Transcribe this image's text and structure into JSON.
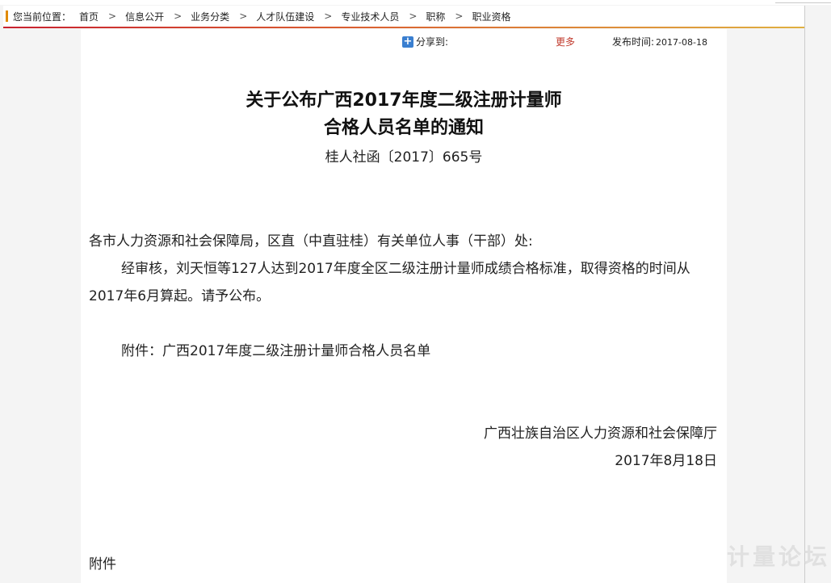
{
  "breadcrumb": {
    "label": "您当前位置：",
    "items": [
      "首页",
      "信息公开",
      "业务分类",
      "人才队伍建设",
      "专业技术人员",
      "职称",
      "职业资格"
    ]
  },
  "meta": {
    "share_label": "分享到:",
    "more_label": "更多",
    "publish_label": "发布时间:",
    "publish_date": "2017-08-18"
  },
  "article": {
    "title_line1": "关于公布广西2017年度二级注册计量师",
    "title_line2": "合格人员名单的通知",
    "doc_number": "桂人社函〔2017〕665号",
    "salutation": "各市人力资源和社会保障局，区直（中直驻桂）有关单位人事（干部）处:",
    "paragraph": "经审核，刘天恒等127人达到2017年度全区二级注册计量师成绩合格标准，取得资格的时间从2017年6月算起。请予公布。",
    "attachment_line": "附件：广西2017年度二级注册计量师合格人员名单",
    "signer": "广西壮族自治区人力资源和社会保障厅",
    "sign_date": "2017年8月18日",
    "attachment_heading": "附件"
  },
  "watermark": "计量论坛",
  "colors": {
    "breadcrumb_marker": "#e08a00",
    "more_link": "#c0392b",
    "share_icon": "#3a7fd0"
  }
}
